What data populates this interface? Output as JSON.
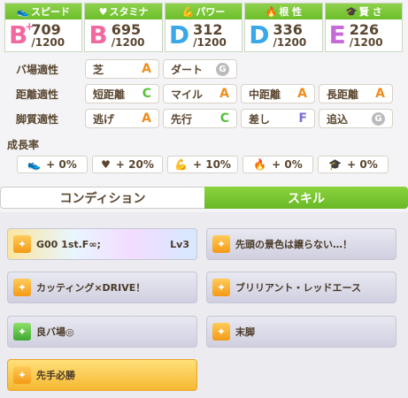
{
  "stats": [
    {
      "label": "スピード",
      "icon": "shoe-icon",
      "grade": "B",
      "plus": "+",
      "value": "709",
      "max": "/1200",
      "grade_color": "#f06aa0"
    },
    {
      "label": "スタミナ",
      "icon": "heart-icon",
      "grade": "B",
      "plus": "",
      "value": "695",
      "max": "/1200",
      "grade_color": "#f06aa0"
    },
    {
      "label": "パワー",
      "icon": "arm-icon",
      "grade": "D",
      "plus": "",
      "value": "312",
      "max": "/1200",
      "grade_color": "#39a7e8"
    },
    {
      "label": "根 性",
      "icon": "flame-icon",
      "grade": "D",
      "plus": "",
      "value": "336",
      "max": "/1200",
      "grade_color": "#39a7e8"
    },
    {
      "label": "賢 さ",
      "icon": "graduation-cap-icon",
      "grade": "E",
      "plus": "",
      "value": "226",
      "max": "/1200",
      "grade_color": "#c66ad8"
    }
  ],
  "aptitude": {
    "track": {
      "label": "バ場適性",
      "items": [
        {
          "name": "芝",
          "grade": "A"
        },
        {
          "name": "ダート",
          "grade": "G"
        }
      ]
    },
    "distance": {
      "label": "距離適性",
      "items": [
        {
          "name": "短距離",
          "grade": "C"
        },
        {
          "name": "マイル",
          "grade": "A"
        },
        {
          "name": "中距離",
          "grade": "A"
        },
        {
          "name": "長距離",
          "grade": "A"
        }
      ]
    },
    "style": {
      "label": "脚質適性",
      "items": [
        {
          "name": "逃げ",
          "grade": "A"
        },
        {
          "name": "先行",
          "grade": "C"
        },
        {
          "name": "差し",
          "grade": "F"
        },
        {
          "name": "追込",
          "grade": "G"
        }
      ]
    }
  },
  "growth": {
    "title": "成長率",
    "items": [
      {
        "icon": "shoe-icon",
        "value": "+ 0%"
      },
      {
        "icon": "heart-icon",
        "value": "+ 20%"
      },
      {
        "icon": "arm-icon",
        "value": "+ 10%"
      },
      {
        "icon": "flame-icon",
        "value": "+ 0%"
      },
      {
        "icon": "graduation-cap-icon",
        "value": "+ 0%"
      }
    ]
  },
  "tabs": {
    "condition": "コンディション",
    "skill": "スキル",
    "active": "skill"
  },
  "skills": [
    {
      "name": "G00 1st.F∞;",
      "level": "Lv3",
      "style": "rainbow",
      "icon": "orange"
    },
    {
      "name": "先頭の景色は譲らない…！",
      "level": "",
      "style": "normal",
      "icon": "orange"
    },
    {
      "name": "カッティング×DRIVE！",
      "level": "",
      "style": "normal",
      "icon": "orange"
    },
    {
      "name": "ブリリアント・レッドエース",
      "level": "",
      "style": "normal",
      "icon": "orange"
    },
    {
      "name": "良バ場◎",
      "level": "",
      "style": "normal",
      "icon": "green"
    },
    {
      "name": "末脚",
      "level": "",
      "style": "normal",
      "icon": "orange"
    },
    {
      "name": "先手必勝",
      "level": "",
      "style": "gold",
      "icon": "orange"
    }
  ],
  "colors": {
    "accent_green": "#6cbf2a",
    "grade_A": "#f08c1c",
    "grade_C": "#58c23a",
    "grade_F": "#7a6cd8",
    "grade_G": "#999999"
  }
}
